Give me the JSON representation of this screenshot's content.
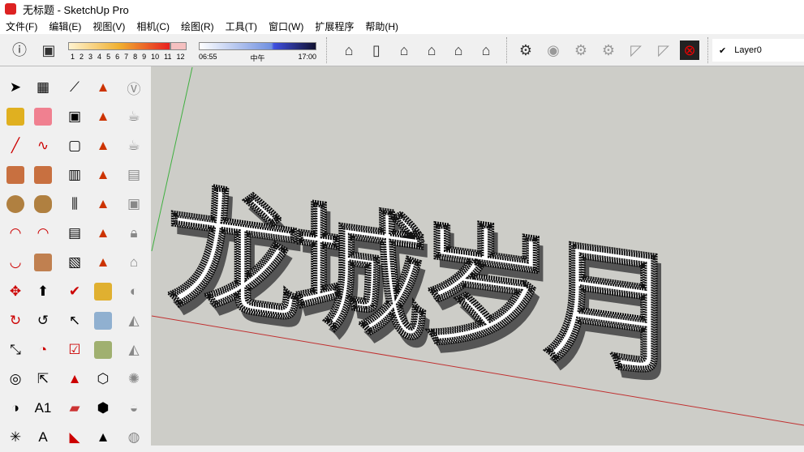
{
  "window": {
    "title": "无标题 - SketchUp Pro"
  },
  "menu": [
    "文件(F)",
    "编辑(E)",
    "视图(V)",
    "相机(C)",
    "绘图(R)",
    "工具(T)",
    "窗口(W)",
    "扩展程序",
    "帮助(H)"
  ],
  "shadow": {
    "months": [
      "1",
      "2",
      "3",
      "4",
      "5",
      "6",
      "7",
      "8",
      "9",
      "10",
      "11",
      "12"
    ],
    "month_value": 10.5,
    "time_start": "06:55",
    "time_mid": "中午",
    "time_end": "17:00",
    "time_value": 0.62
  },
  "layer": {
    "name": "Layer0",
    "check": "✔"
  },
  "model_lettering": "龙城岁月",
  "colors": {
    "viewport": "#cdcdc8",
    "axis_red": "#c03030",
    "axis_green": "#40b040"
  }
}
